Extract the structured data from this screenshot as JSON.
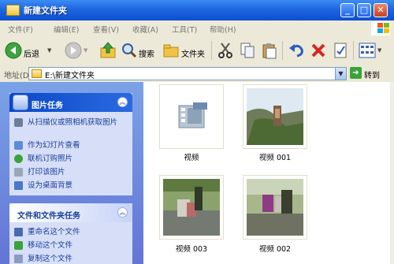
{
  "window": {
    "title": "新建文件夹"
  },
  "menu": [
    "文件(F)",
    "编辑(E)",
    "查看(V)",
    "收藏(A)",
    "工具(T)",
    "帮助(H)"
  ],
  "toolbar": {
    "back_label": "后退",
    "search_label": "搜索",
    "folders_label": "文件夹"
  },
  "address": {
    "label": "地址(D)",
    "path": "E:\\新建文件夹",
    "go_label": "转到"
  },
  "picture_tasks": {
    "title": "图片任务",
    "items": [
      "从扫描仪或照相机获取图片",
      "作为幻灯片查看",
      "联机订购照片",
      "打印该图片",
      "设为桌面背景"
    ]
  },
  "file_tasks": {
    "title": "文件和文件夹任务",
    "items": [
      "重命名这个文件",
      "移动这个文件",
      "复制这个文件"
    ]
  },
  "files": [
    {
      "name": "视频"
    },
    {
      "name": "视频 001"
    },
    {
      "name": "视频 003"
    },
    {
      "name": "视频 002"
    }
  ]
}
